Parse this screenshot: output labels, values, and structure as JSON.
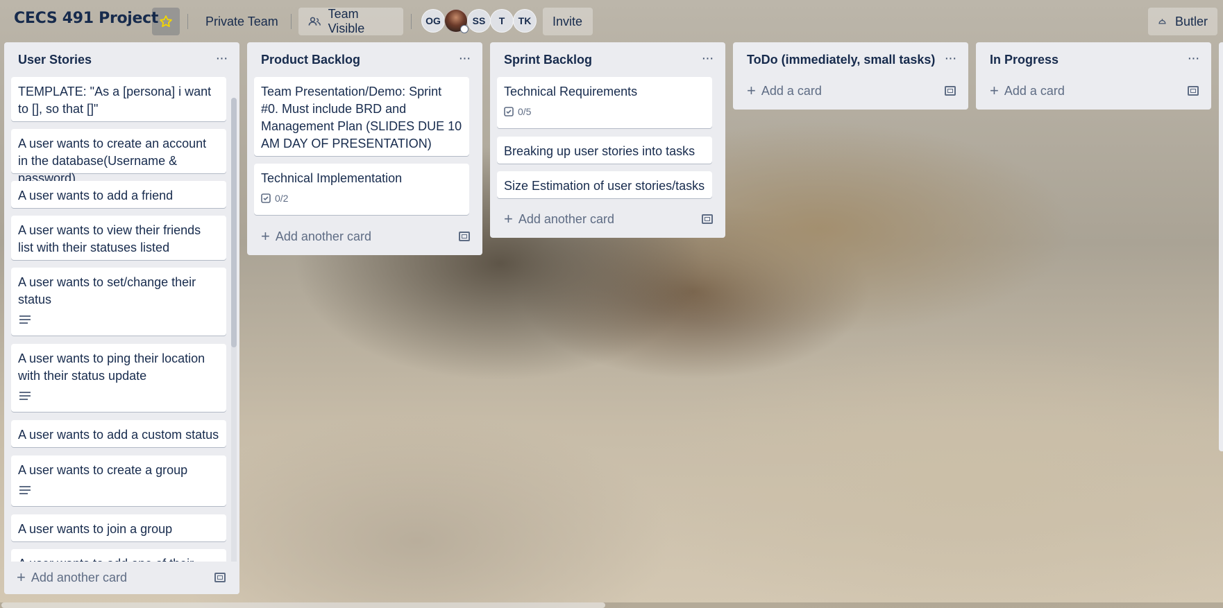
{
  "header": {
    "board_title": "CECS 491 Project",
    "star_icon": "star-icon",
    "team_label": "Private Team",
    "visibility_label": "Team Visible",
    "members": [
      "OG",
      "",
      "SS",
      "T",
      "TK"
    ],
    "invite_label": "Invite",
    "butler_label": "Butler"
  },
  "lists": [
    {
      "title": "User Stories",
      "cards": [
        {
          "text": "TEMPLATE: \"As a [persona] i want to [], so that []\""
        },
        {
          "text": "A user wants to create an account in the database(Username & password)"
        },
        {
          "text": "A user wants to add a friend"
        },
        {
          "text": "A user wants to view their friends list with their statuses listed"
        },
        {
          "text": "A user wants to set/change their status",
          "description": true
        },
        {
          "text": "A user wants to ping their location with their status update",
          "description": true
        },
        {
          "text": "A user wants to add a custom status"
        },
        {
          "text": "A user wants to create a group",
          "description": true
        },
        {
          "text": "A user wants to join a group"
        },
        {
          "text": "A user wants to add one of their"
        }
      ],
      "add_label": "Add another card"
    },
    {
      "title": "Product Backlog",
      "cards": [
        {
          "text": "Team Presentation/Demo: Sprint #0. Must include BRD and Management Plan (SLIDES DUE 10 AM DAY OF PRESENTATION)"
        },
        {
          "text": "Technical Implementation",
          "checklist": "0/2"
        }
      ],
      "add_label": "Add another card"
    },
    {
      "title": "Sprint Backlog",
      "cards": [
        {
          "text": "Technical Requirements",
          "checklist": "0/5"
        },
        {
          "text": "Breaking up user stories into tasks"
        },
        {
          "text": "Size Estimation of user stories/tasks"
        }
      ],
      "add_label": "Add another card"
    },
    {
      "title": "ToDo (immediately, small tasks)",
      "cards": [],
      "add_label": "Add a card"
    },
    {
      "title": "In Progress",
      "cards": [],
      "add_label": "Add a card"
    }
  ],
  "list_menu_glyph": "···",
  "checklist_icon": "checklist-icon",
  "description_icon": "description-icon"
}
